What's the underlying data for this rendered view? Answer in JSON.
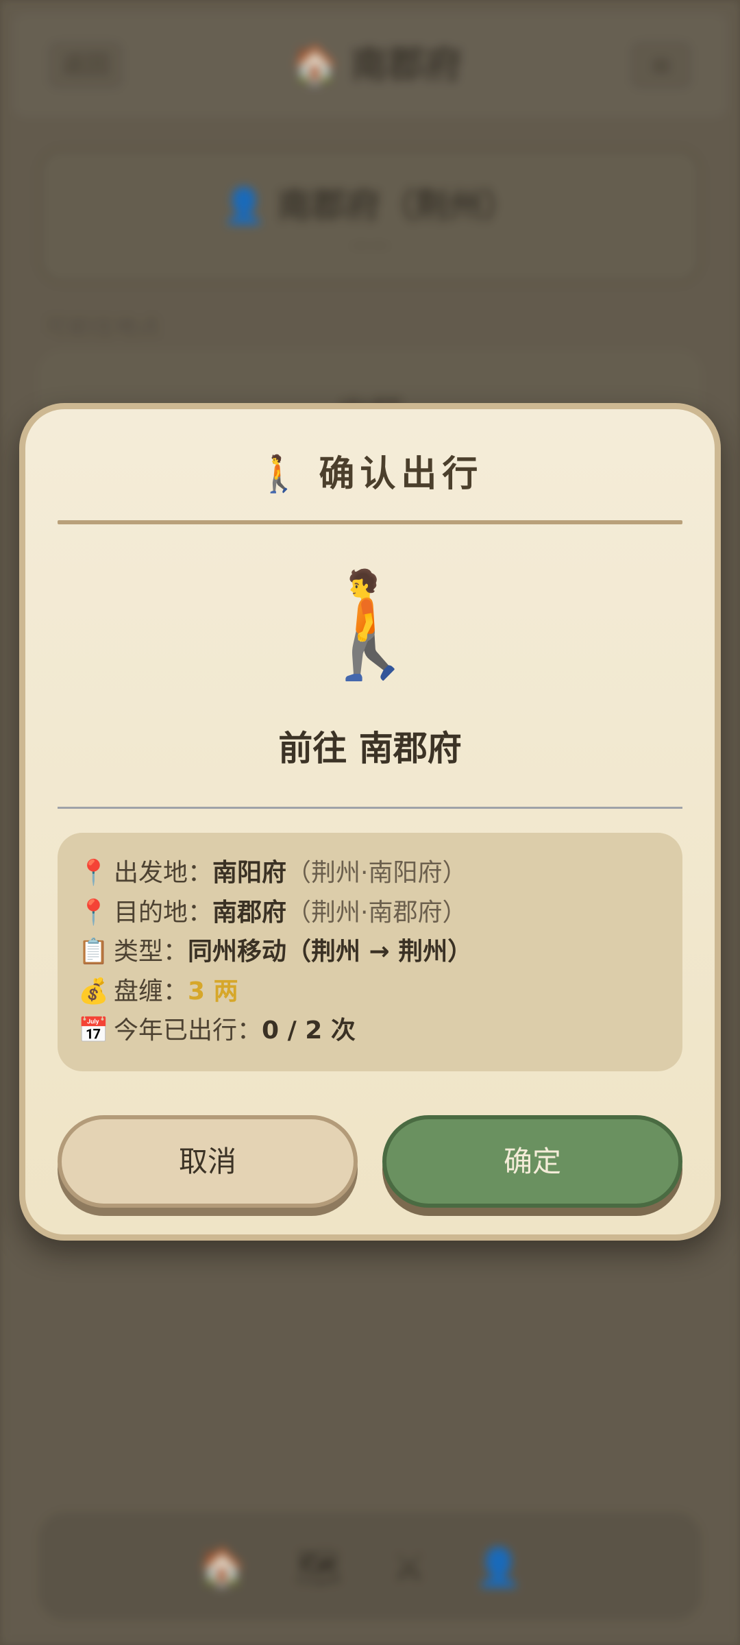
{
  "background": {
    "back_label": "返回",
    "title": "🏠 南郡府",
    "menu_label": "≡",
    "card_title": "👤 南郡府（荆州）",
    "card_sub": "——",
    "section_label": "可前往地点",
    "card2_title": "出行",
    "nav_icons": "🏠 🗺 ⚔ 👤"
  },
  "dialog": {
    "title_icon": "🚶",
    "title": "确认出行",
    "hero_icon": "🚶",
    "destination_text": "前往 南郡府",
    "info": {
      "origin": {
        "icon": "📍",
        "label": "出发地：",
        "value": "南阳府",
        "note": "（荆州·南阳府）"
      },
      "destination": {
        "icon": "📍",
        "label": "目的地：",
        "value": "南郡府",
        "note": "（荆州·南郡府）"
      },
      "type": {
        "icon": "📋",
        "label": "类型：",
        "value": "同州移动（荆州 → 荆州）"
      },
      "cost": {
        "icon": "💰",
        "label": "盘缠：",
        "value": "3 两"
      },
      "count": {
        "icon": "📅",
        "label": "今年已出行：",
        "value": "0 / 2 次"
      }
    },
    "cancel_label": "取消",
    "confirm_label": "确定"
  },
  "colors": {
    "dialog_bg": "#f4ecd8",
    "dialog_border": "#cdb892",
    "info_bg": "#dccdaa",
    "cancel_bg": "#e4d3b4",
    "confirm_bg": "#6a9160",
    "gold": "#d6a72a"
  }
}
